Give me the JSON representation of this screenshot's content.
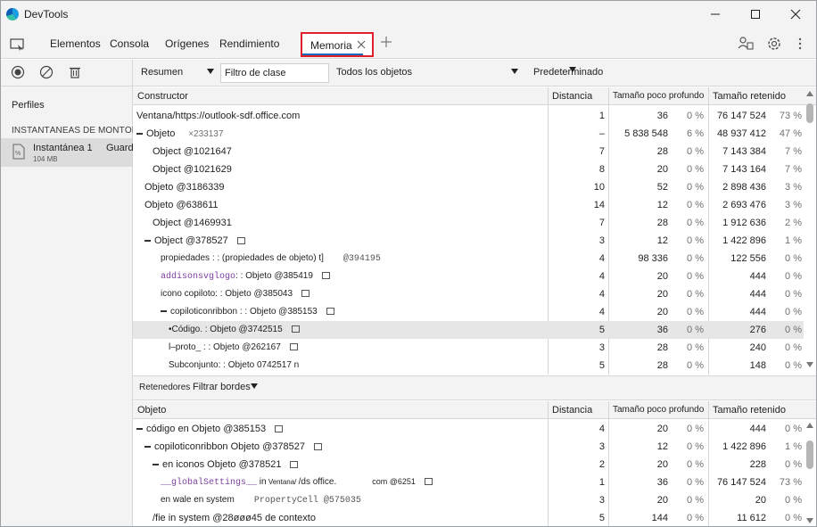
{
  "window": {
    "title": "DevTools"
  },
  "tabs": {
    "items": [
      "Elementos",
      "Consola",
      "Orígenes",
      "Rendimiento"
    ],
    "active": "Memoria"
  },
  "sidebar": {
    "profiles_label": "Perfiles",
    "heap_header": "INSTANTÁNEAS DE MONTÓN",
    "snapshot_name": "Instantánea 1",
    "snapshot_size": "104 MB",
    "save_label": "Guardar"
  },
  "toolbar": {
    "view": "Resumen",
    "class_filter_value": "Filtro de clase",
    "objects_filter": "Todos los objetos",
    "preset": "Predeterminado"
  },
  "main_table": {
    "headers": [
      "Constructor",
      "Distancia",
      "Tamaño poco profundo",
      "Tamaño retenido"
    ],
    "rows": [
      {
        "name": "Ventana/https://outlook-sdf.office.com",
        "indent": 0,
        "toggle": false,
        "suffix": "",
        "mono": "",
        "box": false,
        "dist": "1",
        "shallow": "36",
        "sp": "0 %",
        "retained": "76 147 524",
        "rp": "73 %"
      },
      {
        "name": "Objeto",
        "indent": 0,
        "toggle": true,
        "suffix": "×233137",
        "mono": "",
        "box": false,
        "dist": "–",
        "shallow": "5 838 548",
        "sp": "6 %",
        "retained": "48 937 412",
        "rp": "47 %"
      },
      {
        "name": "Object @1021647",
        "indent": 2,
        "toggle": false,
        "suffix": "",
        "mono": "",
        "box": false,
        "dist": "7",
        "shallow": "28",
        "sp": "0 %",
        "retained": "7 143 384",
        "rp": "7 %"
      },
      {
        "name": "Object @1021629",
        "indent": 2,
        "toggle": false,
        "suffix": "",
        "mono": "",
        "box": false,
        "dist": "8",
        "shallow": "20",
        "sp": "0 %",
        "retained": "7 143 164",
        "rp": "7 %"
      },
      {
        "name": "Objeto @3186339",
        "indent": 1,
        "toggle": false,
        "suffix": "",
        "mono": "",
        "box": false,
        "dist": "10",
        "shallow": "52",
        "sp": "0 %",
        "retained": "2 898 436",
        "rp": "3 %"
      },
      {
        "name": "Objeto @638611",
        "indent": 1,
        "toggle": false,
        "suffix": "",
        "mono": "",
        "box": false,
        "dist": "14",
        "shallow": "12",
        "sp": "0 %",
        "retained": "2 693 476",
        "rp": "3 %"
      },
      {
        "name": "Object @1469931",
        "indent": 2,
        "toggle": false,
        "suffix": "",
        "mono": "",
        "box": false,
        "dist": "7",
        "shallow": "28",
        "sp": "0 %",
        "retained": "1 912 636",
        "rp": "2 %"
      },
      {
        "name": "Object @378527",
        "indent": 1,
        "toggle": true,
        "suffix": "",
        "mono": "",
        "box": true,
        "dist": "3",
        "shallow": "12",
        "sp": "0 %",
        "retained": "1 422 896",
        "rp": "1 %"
      },
      {
        "name": "propiedades    : :   (propiedades de objeto) t]",
        "indent": 3,
        "toggle": false,
        "suffix": "",
        "mono": "@394195",
        "box": false,
        "dist": "4",
        "shallow": "98 336",
        "sp": "0 %",
        "retained": "122 556",
        "rp": "0 %"
      },
      {
        "name": ": :  Objeto @385419",
        "indent": 3,
        "toggle": false,
        "suffix": "",
        "mono": "",
        "monoPrefix": "addisonsvglogo",
        "box": true,
        "dist": "4",
        "shallow": "20",
        "sp": "0 %",
        "retained": "444",
        "rp": "0 %"
      },
      {
        "name": "icono copiloto: :              Objeto @385043",
        "indent": 3,
        "toggle": false,
        "suffix": "",
        "mono": "",
        "box": true,
        "dist": "4",
        "shallow": "20",
        "sp": "0 %",
        "retained": "444",
        "rp": "0 %"
      },
      {
        "name": "copiloticonribbon : :                    Objeto @385153",
        "indent": 3,
        "toggle": true,
        "suffix": "",
        "mono": "",
        "box": true,
        "dist": "4",
        "shallow": "20",
        "sp": "0 %",
        "retained": "444",
        "rp": "0 %"
      },
      {
        "name": "•Código.  :   Objeto @3742515",
        "indent": 4,
        "toggle": false,
        "suffix": "",
        "mono": "",
        "box": true,
        "dist": "5",
        "shallow": "36",
        "sp": "0 %",
        "retained": "276",
        "rp": "0 %",
        "selected": true
      },
      {
        "name": "l–proto_           : :  Objeto @262167",
        "indent": 4,
        "toggle": false,
        "suffix": "",
        "mono": "",
        "box": true,
        "dist": "3",
        "shallow": "28",
        "sp": "0 %",
        "retained": "240",
        "rp": "0 %"
      },
      {
        "name": "Subconjunto: :    Objeto 0742517 n",
        "indent": 4,
        "toggle": false,
        "suffix": "",
        "mono": "",
        "box": false,
        "dist": "5",
        "shallow": "28",
        "sp": "0 %",
        "retained": "148",
        "rp": "0 %"
      }
    ]
  },
  "retainers_bar": {
    "label": "Retenedores",
    "filter": "Filtrar bordes"
  },
  "ret_table": {
    "headers": [
      "Objeto",
      "Distancia",
      "Tamaño poco profundo",
      "Tamaño retenido"
    ],
    "rows": [
      {
        "name": "código en  Objeto @385153",
        "indent": 0,
        "toggle": true,
        "box": true,
        "dist": "4",
        "shallow": "20",
        "sp": "0 %",
        "retained": "444",
        "rp": "0 %"
      },
      {
        "name": "copiloticonribbon                Objeto @378527",
        "indent": 1,
        "toggle": true,
        "box": true,
        "dist": "3",
        "shallow": "12",
        "sp": "0 %",
        "retained": "1 422 896",
        "rp": "1 %"
      },
      {
        "name": "en iconos   Objeto @378521",
        "indent": 2,
        "toggle": true,
        "box": true,
        "dist": "2",
        "shallow": "20",
        "sp": "0 %",
        "retained": "228",
        "rp": "0 %"
      },
      {
        "name": "  in",
        "monoPrefix": "__globalSettings__",
        "extra": "Ventana/",
        "tail": "/ds office.",
        "tail2": "com @6251",
        "indent": 3,
        "toggle": false,
        "box": true,
        "dist": "1",
        "shallow": "36",
        "sp": "0 %",
        "retained": "76 147 524",
        "rp": "73 %"
      },
      {
        "name": "en wale en system",
        "mono": "PropertyCell @575035",
        "indent": 3,
        "toggle": false,
        "box": false,
        "dist": "3",
        "shallow": "20",
        "sp": "0 %",
        "retained": "20",
        "rp": "0 %"
      },
      {
        "name": "/fie in system              @28øøø45 de contexto",
        "indent": 2,
        "toggle": false,
        "box": false,
        "dist": "5",
        "shallow": "144",
        "sp": "0 %",
        "retained": "11 612",
        "rp": "0 %"
      }
    ]
  },
  "colors": {
    "accent": "#0f6cbd",
    "highlight_border": "#e0212b",
    "chrome_bg": "#f3f3f3",
    "selected_row": "#e6e6e6"
  },
  "icons": [
    "edge-logo-icon",
    "minimize-icon",
    "maximize-icon",
    "close-icon",
    "device-toggle-icon",
    "close-tab-icon",
    "plus-icon",
    "customize-icon",
    "settings-icon",
    "more-icon",
    "record-icon",
    "clear-icon",
    "trash-icon",
    "snapshot-file-icon"
  ]
}
